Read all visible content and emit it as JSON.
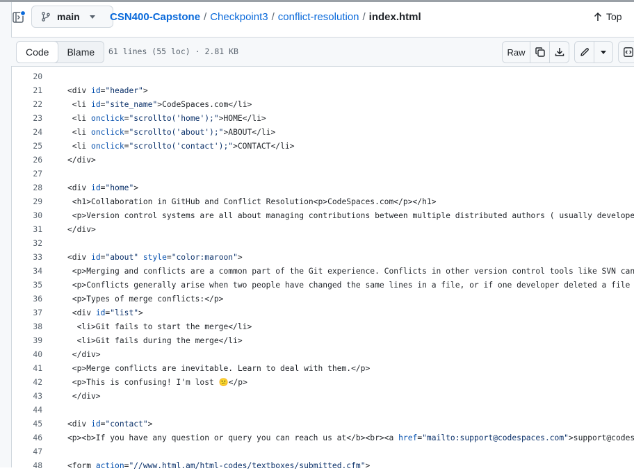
{
  "breadcrumb": {
    "branch": "main",
    "repo": "CSN400-Capstone",
    "folder1": "Checkpoint3",
    "folder2": "conflict-resolution",
    "sep": "/",
    "file": "index.html",
    "top_label": "Top"
  },
  "file_header": {
    "code_tab": "Code",
    "blame_tab": "Blame",
    "info": "61 lines (55 loc) · 2.81 KB",
    "raw_label": "Raw"
  },
  "icons": {
    "panel": "sidebar-toggle-icon",
    "branch": "git-branch-icon",
    "top": "arrow-up-icon",
    "copy": "copy-icon",
    "download": "download-icon",
    "edit": "pencil-icon",
    "more": "triangle-down-icon",
    "symbols": "code-square-icon"
  },
  "colors": {
    "link": "#0969da",
    "attr": "#0550ae",
    "string": "#0a3069",
    "muted": "#59636e"
  },
  "code_lines": [
    {
      "n": "20",
      "t": ""
    },
    {
      "n": "21",
      "t": "<div id=\"header\">"
    },
    {
      "n": "22",
      "t": " <li id=\"site_name\">CodeSpaces.com</li>"
    },
    {
      "n": "23",
      "t": " <li onclick=\"scrollto('home');\">HOME</li>"
    },
    {
      "n": "24",
      "t": " <li onclick=\"scrollto('about');\">ABOUT</li>"
    },
    {
      "n": "25",
      "t": " <li onclick=\"scrollto('contact');\">CONTACT</li>"
    },
    {
      "n": "26",
      "t": "</div>"
    },
    {
      "n": "27",
      "t": ""
    },
    {
      "n": "28",
      "t": "<div id=\"home\">"
    },
    {
      "n": "29",
      "t": " <h1>Collaboration in GitHub and Conflict Resolution<p>CodeSpaces.com</p></h1>"
    },
    {
      "n": "30",
      "t": " <p>Version control systems are all about managing contributions between multiple distributed authors ( usually developers )"
    },
    {
      "n": "31",
      "t": "</div>"
    },
    {
      "n": "32",
      "t": ""
    },
    {
      "n": "33",
      "t": "<div id=\"about\" style=\"color:maroon\">"
    },
    {
      "n": "34",
      "t": " <p>Merging and conflicts are a common part of the Git experience. Conflicts in other version control tools like SVN can be"
    },
    {
      "n": "35",
      "t": " <p>Conflicts generally arise when two people have changed the same lines in a file, or if one developer deleted a file whil"
    },
    {
      "n": "36",
      "t": " <p>Types of merge conflicts:</p>"
    },
    {
      "n": "37",
      "t": " <div id=\"list\">"
    },
    {
      "n": "38",
      "t": "  <li>Git fails to start the merge</li>"
    },
    {
      "n": "39",
      "t": "  <li>Git fails during the merge</li>"
    },
    {
      "n": "40",
      "t": " </div>"
    },
    {
      "n": "41",
      "t": " <p>Merge conflicts are inevitable. Learn to deal with them.</p>"
    },
    {
      "n": "42",
      "t": " <p>This is confusing! I'm lost 😕</p>"
    },
    {
      "n": "43",
      "t": " </div>"
    },
    {
      "n": "44",
      "t": ""
    },
    {
      "n": "45",
      "t": "<div id=\"contact\">"
    },
    {
      "n": "46",
      "t": "<p><b>If you have any question or query you can reach us at</b><br><a href=\"mailto:support@codespaces.com\">support@codespace"
    },
    {
      "n": "47",
      "t": ""
    },
    {
      "n": "48",
      "t": "<form action=\"//www.html.am/html-codes/textboxes/submitted.cfm\">"
    }
  ]
}
